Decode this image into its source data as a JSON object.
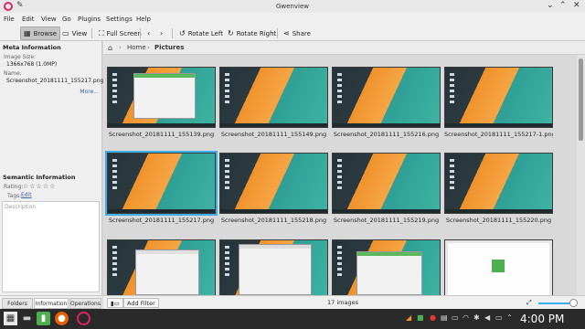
{
  "window": {
    "title": "Gwenview"
  },
  "menu": [
    "File",
    "Edit",
    "View",
    "Go",
    "Plugins",
    "Settings",
    "Help"
  ],
  "toolbar": {
    "browse": "Browse",
    "view": "View",
    "fullscreen": "Full Screen",
    "rotate_left": "Rotate Left",
    "rotate_right": "Rotate Right",
    "share": "Share"
  },
  "sidebar": {
    "meta_title": "Meta Information",
    "image_size_label": "Image Size:",
    "image_size_value": "1366x768 (1.0MP)",
    "name_label": "Name:",
    "name_value": "Screenshot_20181111_155217.png",
    "more": "More...",
    "semantic_title": "Semantic Information",
    "rating_label": "Rating:",
    "rating_stars": "☆☆☆☆☆",
    "tags_label": "Tags:",
    "tags_edit": "Edit",
    "description_placeholder": "Description",
    "tabs": [
      "Folders",
      "Information",
      "Operations"
    ]
  },
  "breadcrumb": {
    "home": "Home",
    "separator": "›",
    "current": "Pictures"
  },
  "thumbnails": [
    {
      "caption": "Screenshot_20181111_155139.png"
    },
    {
      "caption": "Screenshot_20181111_155149.png"
    },
    {
      "caption": "Screenshot_20181111_155216.png"
    },
    {
      "caption": "Screenshot_20181111_155217-1.png"
    },
    {
      "caption": "Screenshot_20181111_155217.png"
    },
    {
      "caption": "Screenshot_20181111_155218.png"
    },
    {
      "caption": "Screenshot_20181111_155219.png"
    },
    {
      "caption": "Screenshot_20181111_155220.png"
    },
    {
      "caption": ""
    },
    {
      "caption": ""
    },
    {
      "caption": ""
    },
    {
      "caption": ""
    }
  ],
  "statusbar": {
    "add_filter": "Add Filter",
    "count": "17 images",
    "zoom_fraction": 0.85
  },
  "taskbar": {
    "clock": "4:00 PM"
  },
  "colors": {
    "accent": "#3daee9",
    "selection": "#3daee9",
    "orange": "#f0922c",
    "teal": "#3fb3a4"
  }
}
